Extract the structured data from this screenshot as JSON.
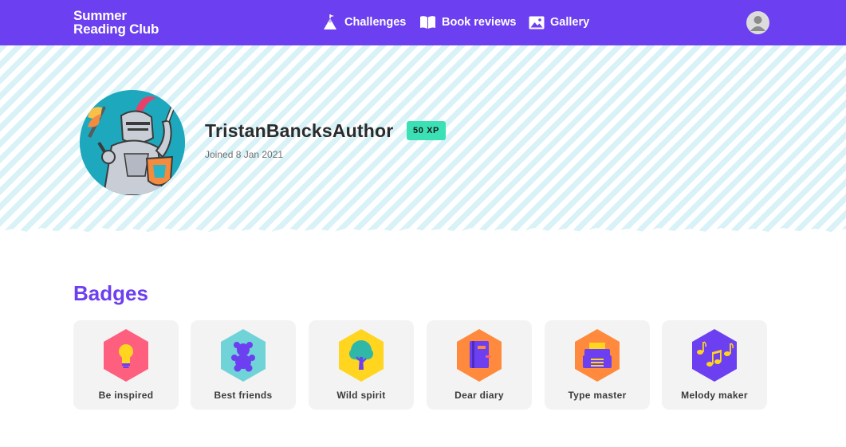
{
  "app": {
    "logo_line1": "Summer",
    "logo_line2": "Reading Club"
  },
  "nav": {
    "items": [
      {
        "label": "Challenges",
        "icon": "mountain-flag-icon"
      },
      {
        "label": "Book reviews",
        "icon": "open-book-icon"
      },
      {
        "label": "Gallery",
        "icon": "image-icon"
      }
    ],
    "account_icon": "user-avatar-icon"
  },
  "profile": {
    "username": "TristanBancksAuthor",
    "xp": "50 XP",
    "joined": "Joined 8 Jan 2021",
    "avatar": "knight-avatar"
  },
  "badges": {
    "title": "Badges",
    "items": [
      {
        "label": "Be inspired",
        "icon": "lightbulb-icon",
        "color": "#ff5f7e"
      },
      {
        "label": "Best friends",
        "icon": "teddy-bear-icon",
        "color": "#6fd3d8"
      },
      {
        "label": "Wild spirit",
        "icon": "tree-icon",
        "color": "#ffd51f"
      },
      {
        "label": "Dear diary",
        "icon": "diary-icon",
        "color": "#ff8a3d"
      },
      {
        "label": "Type master",
        "icon": "typewriter-icon",
        "color": "#ff8a3d"
      },
      {
        "label": "Melody maker",
        "icon": "music-notes-icon",
        "color": "#6c3ff0"
      }
    ]
  },
  "colors": {
    "brand": "#6c3ff0",
    "xp_badge": "#3be0b4",
    "hero_stripe": "#d8f2f7"
  }
}
